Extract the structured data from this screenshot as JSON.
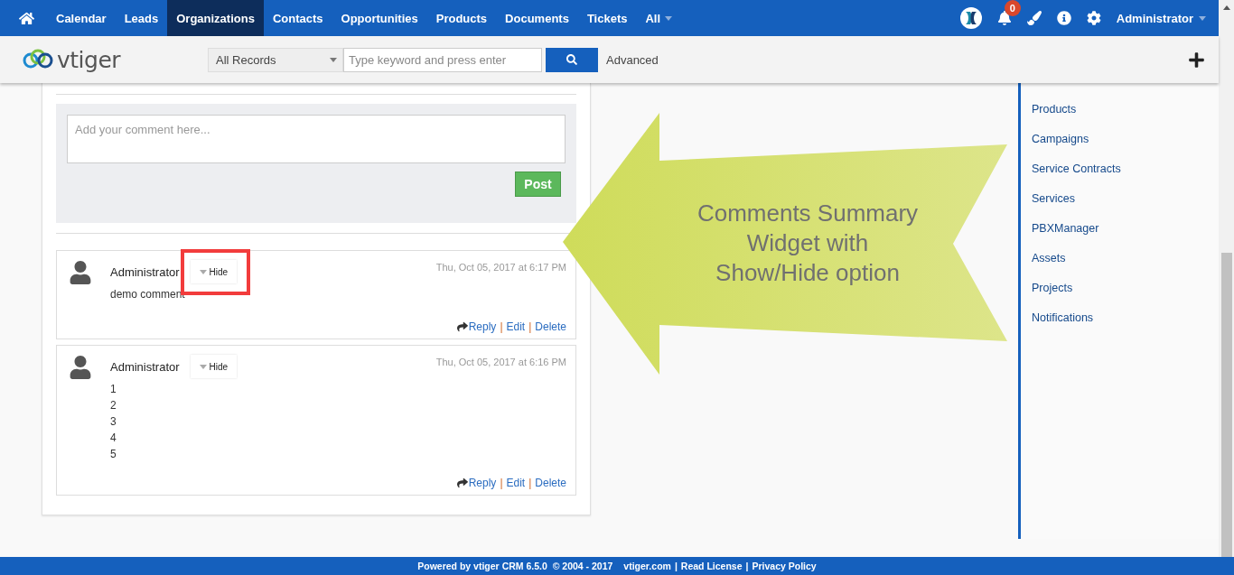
{
  "nav": {
    "items": [
      {
        "label": "Calendar",
        "selected": false
      },
      {
        "label": "Leads",
        "selected": false
      },
      {
        "label": "Organizations",
        "selected": true
      },
      {
        "label": "Contacts",
        "selected": false
      },
      {
        "label": "Opportunities",
        "selected": false
      },
      {
        "label": "Products",
        "selected": false
      },
      {
        "label": "Documents",
        "selected": false
      },
      {
        "label": "Tickets",
        "selected": false
      },
      {
        "label": "All",
        "selected": false
      }
    ],
    "notification_count": "0",
    "user": "Administrator"
  },
  "toolbar": {
    "logo": "vtiger",
    "scope": "All Records",
    "search_placeholder": "Type keyword and press enter",
    "advanced": "Advanced"
  },
  "comment_form": {
    "placeholder": "Add your comment here...",
    "post": "Post"
  },
  "comments": [
    {
      "author": "Administrator",
      "toggle": "Hide",
      "highlighted": true,
      "time": "Thu, Oct 05, 2017 at 6:17 PM",
      "lines": [
        "demo comment"
      ],
      "actions": [
        "Reply",
        "Edit",
        "Delete"
      ],
      "separator": "|"
    },
    {
      "author": "Administrator",
      "toggle": "Hide",
      "highlighted": false,
      "time": "Thu, Oct 05, 2017 at 6:16 PM",
      "lines": [
        "1",
        "2",
        "3",
        "4",
        "5"
      ],
      "actions": [
        "Reply",
        "Edit",
        "Delete"
      ],
      "separator": "|"
    }
  ],
  "callout": {
    "lines": [
      "Comments Summary",
      "Widget with",
      "Show/Hide option"
    ]
  },
  "sidebar": {
    "items": [
      "Products",
      "Campaigns",
      "Service Contracts",
      "Services",
      "PBXManager",
      "Assets",
      "Projects",
      "Notifications"
    ]
  },
  "footer": {
    "parts": [
      {
        "kind": "text",
        "text": "Powered by vtiger CRM 6.5.0  © 2004 - 2017"
      },
      {
        "kind": "link",
        "text": "vtiger.com"
      },
      {
        "kind": "separator",
        "text": "|"
      },
      {
        "kind": "link",
        "text": "Read License"
      },
      {
        "kind": "separator",
        "text": "|"
      },
      {
        "kind": "link",
        "text": "Privacy Policy"
      }
    ]
  }
}
